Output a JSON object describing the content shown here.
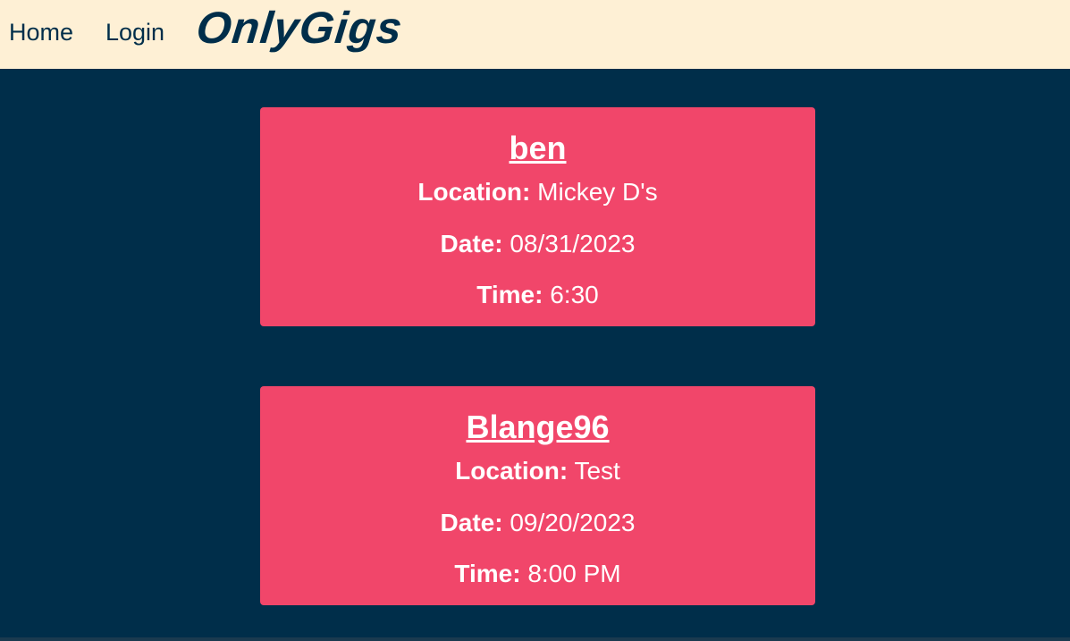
{
  "nav": {
    "home_label": "Home",
    "login_label": "Login",
    "brand": "OnlyGigs"
  },
  "colors": {
    "navbar_bg": "#FEF0D5",
    "page_bg": "#002E4A",
    "card_bg": "#F1466A",
    "text_dark": "#002E4A",
    "text_light": "#FFFFFF"
  },
  "gigs": [
    {
      "name": "ben",
      "location_label": "Location:",
      "location": "Mickey D's",
      "date_label": "Date:",
      "date": "08/31/2023",
      "time_label": "Time:",
      "time": "6:30"
    },
    {
      "name": "Blange96",
      "location_label": "Location:",
      "location": "Test",
      "date_label": "Date:",
      "date": "09/20/2023",
      "time_label": "Time:",
      "time": "8:00 PM"
    }
  ]
}
